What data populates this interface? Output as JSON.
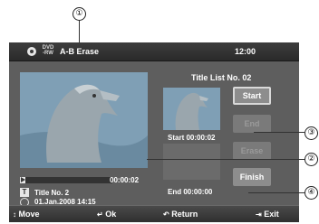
{
  "callouts": [
    "①",
    "②",
    "③",
    "④"
  ],
  "header": {
    "disc_top": "DVD",
    "disc_bottom": "-RW",
    "title": "A-B Erase",
    "clock": "12:00"
  },
  "list_title": "Title List No. 02",
  "buttons": {
    "start": "Start",
    "end": "End",
    "erase": "Erase",
    "finish": "Finish"
  },
  "start_time": "Start 00:00:02",
  "end_time": "End 00:00:00",
  "playback": {
    "time": "00:00:02",
    "progress": 0.06
  },
  "info": {
    "title_icon": "T",
    "title_name": "Title No. 2",
    "date": "01.Jan.2008 14:15"
  },
  "hints": {
    "move": "Move",
    "ok": "Ok",
    "return": "Return",
    "exit": "Exit"
  }
}
